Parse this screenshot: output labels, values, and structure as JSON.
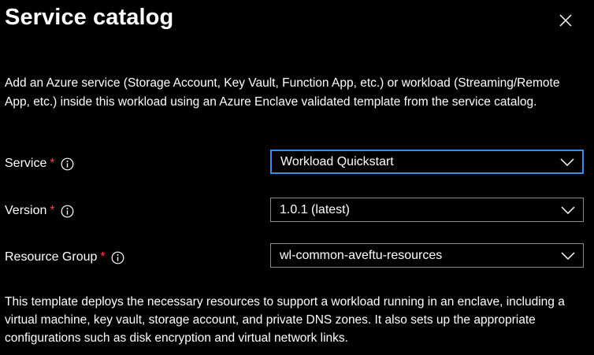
{
  "panel": {
    "title": "Service catalog",
    "close_icon": "close-icon",
    "description": "Add an Azure service (Storage Account, Key Vault, Function App, etc.) or workload (Streaming/Remote App, etc.) inside this workload using an Azure Enclave validated template from the service catalog."
  },
  "form": {
    "service": {
      "label": "Service",
      "required_mark": "*",
      "info_icon": "info-icon",
      "value": "Workload Quickstart"
    },
    "version": {
      "label": "Version",
      "required_mark": "*",
      "info_icon": "info-icon",
      "value": "1.0.1 (latest)"
    },
    "resource_group": {
      "label": "Resource Group",
      "required_mark": "*",
      "info_icon": "info-icon",
      "value": "wl-common-aveftu-resources"
    }
  },
  "footer": {
    "text": "This template deploys the necessary resources to support a workload running in an enclave, including a virtual machine, key vault, storage account, and private DNS zones. It also sets up the appropriate configurations such as disk encryption and virtual network links."
  },
  "colors": {
    "background": "#000000",
    "text": "#ffffff",
    "required": "#ff4040",
    "focus_border": "#3b8ee8",
    "border": "#8a8a8a"
  }
}
